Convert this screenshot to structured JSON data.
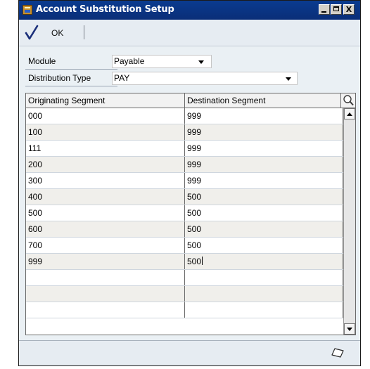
{
  "window": {
    "title": "Account Substitution Setup",
    "controls": {
      "minimize": "_",
      "maximize": "□",
      "close": "X"
    }
  },
  "toolbar": {
    "ok_label": "OK",
    "ok_icon": "checkmark-icon"
  },
  "form": {
    "module_label": "Module",
    "module_value": "Payable",
    "distribution_type_label": "Distribution Type",
    "distribution_type_value": "PAY"
  },
  "grid": {
    "columns": [
      "Originating Segment",
      "Destination Segment"
    ],
    "rows": [
      {
        "orig": "000",
        "dest": "999"
      },
      {
        "orig": "100",
        "dest": "999"
      },
      {
        "orig": "111",
        "dest": "999"
      },
      {
        "orig": "200",
        "dest": "999"
      },
      {
        "orig": "300",
        "dest": "999"
      },
      {
        "orig": "400",
        "dest": "500"
      },
      {
        "orig": "500",
        "dest": "500"
      },
      {
        "orig": "600",
        "dest": "500"
      },
      {
        "orig": "700",
        "dest": "500"
      },
      {
        "orig": "999",
        "dest": "500"
      },
      {
        "orig": "",
        "dest": ""
      },
      {
        "orig": "",
        "dest": ""
      },
      {
        "orig": "",
        "dest": ""
      }
    ]
  },
  "icons": {
    "lookup": "magnifier-icon",
    "note": "note-icon",
    "app": "app-window-icon"
  },
  "colors": {
    "titlebar": "#0a3b8f",
    "body": "#eaf0f4",
    "row_alt": "#f0efeb"
  }
}
